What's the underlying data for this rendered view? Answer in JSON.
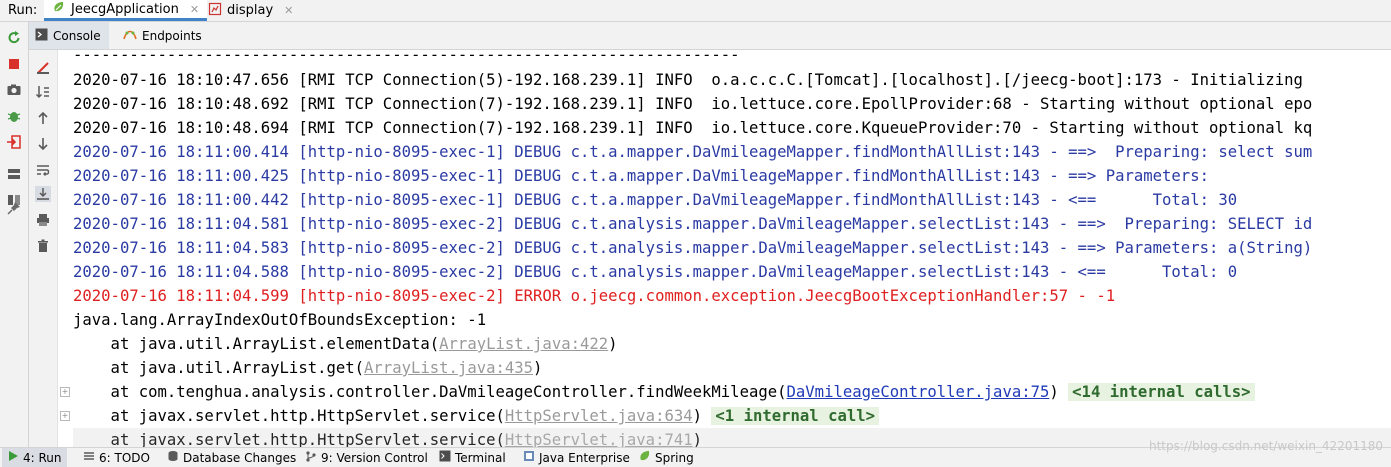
{
  "run_bar": {
    "label": "Run:",
    "tabs": [
      {
        "label": "JeecgApplication",
        "icon": "spring-boot-icon"
      },
      {
        "label": "display",
        "icon": "chart-icon"
      }
    ]
  },
  "sub_tabs": [
    {
      "label": "Console",
      "icon": "console-icon"
    },
    {
      "label": "Endpoints",
      "icon": "endpoints-icon"
    }
  ],
  "console_lines": [
    {
      "text": "-----------------------------------------------------------------------"
    },
    {
      "text": "2020-07-16 18:10:47.656 [RMI TCP Connection(5)-192.168.239.1] INFO  o.a.c.c.C.[Tomcat].[localhost].[/jeecg-boot]:173 - Initializing"
    },
    {
      "text": "2020-07-16 18:10:48.692 [RMI TCP Connection(7)-192.168.239.1] INFO  io.lettuce.core.EpollProvider:68 - Starting without optional epo"
    },
    {
      "text": "2020-07-16 18:10:48.694 [RMI TCP Connection(7)-192.168.239.1] INFO  io.lettuce.core.KqueueProvider:70 - Starting without optional kq"
    },
    {
      "text": "2020-07-16 18:11:00.414 [http-nio-8095-exec-1] DEBUG c.t.a.mapper.DaVmileageMapper.findMonthAllList:143 - ==>  Preparing: select sum"
    },
    {
      "text": "2020-07-16 18:11:00.425 [http-nio-8095-exec-1] DEBUG c.t.a.mapper.DaVmileageMapper.findMonthAllList:143 - ==> Parameters: "
    },
    {
      "text": "2020-07-16 18:11:00.442 [http-nio-8095-exec-1] DEBUG c.t.a.mapper.DaVmileageMapper.findMonthAllList:143 - <==      Total: 30"
    },
    {
      "text": "2020-07-16 18:11:04.581 [http-nio-8095-exec-2] DEBUG c.t.analysis.mapper.DaVmileageMapper.selectList:143 - ==>  Preparing: SELECT id"
    },
    {
      "text": "2020-07-16 18:11:04.583 [http-nio-8095-exec-2] DEBUG c.t.analysis.mapper.DaVmileageMapper.selectList:143 - ==> Parameters: a(String)"
    },
    {
      "text": "2020-07-16 18:11:04.588 [http-nio-8095-exec-2] DEBUG c.t.analysis.mapper.DaVmileageMapper.selectList:143 - <==      Total: 0"
    },
    {
      "text": "2020-07-16 18:11:04.599 [http-nio-8095-exec-2] ERROR o.jeecg.common.exception.JeecgBootExceptionHandler:57 - -1"
    },
    {
      "text": "java.lang.ArrayIndexOutOfBoundsException: -1"
    }
  ],
  "stack": [
    {
      "prefix": "    at java.util.ArrayList.elementData(",
      "link": "ArrayList.java:422",
      "suffix": ")",
      "internal": ""
    },
    {
      "prefix": "    at java.util.ArrayList.get(",
      "link": "ArrayList.java:435",
      "suffix": ")",
      "internal": ""
    },
    {
      "prefix": "    at com.tenghua.analysis.controller.DaVmileageController.findWeekMileage(",
      "link": "DaVmileageController.java:75",
      "suffix": ") ",
      "internal": "<14 internal calls>"
    },
    {
      "prefix": "    at javax.servlet.http.HttpServlet.service(",
      "link": "HttpServlet.java:634",
      "suffix": ") ",
      "internal": "<1 internal call>"
    },
    {
      "prefix": "    at javax.servlet.http.HttpServlet.service(",
      "link": "HttpServlet.java:741",
      "suffix": ")",
      "internal": ""
    }
  ],
  "status_bar": [
    {
      "label": "4: Run",
      "icon": "run-icon"
    },
    {
      "label": "6: TODO",
      "icon": "todo-icon"
    },
    {
      "label": "Database Changes",
      "icon": "database-icon"
    },
    {
      "label": "9: Version Control",
      "icon": "vcs-icon"
    },
    {
      "label": "Terminal",
      "icon": "terminal-icon"
    },
    {
      "label": "Java Enterprise",
      "icon": "java-enterprise-icon"
    },
    {
      "label": "Spring",
      "icon": "spring-icon"
    }
  ],
  "watermark": "https://blog.csdn.net/weixin_42201180",
  "colors": {
    "info": "#000000",
    "debug": "#2a3aa3",
    "error": "#e02020",
    "link": "#9a9a9a",
    "link_project": "#1f3bb8",
    "internal_bg": "#e8f2e0",
    "tab_accent": "#4083c9"
  }
}
